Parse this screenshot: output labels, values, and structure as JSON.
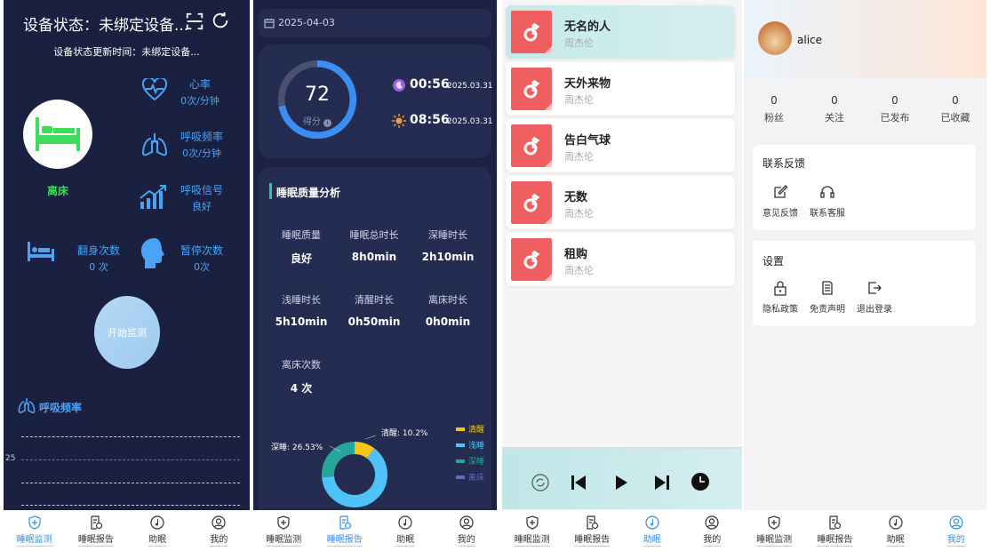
{
  "tabs": [
    "睡眠监测",
    "睡眠报告",
    "助眠",
    "我的"
  ],
  "monitor": {
    "title": "设备状态：未绑定设备...",
    "subtitle": "设备状态更新时间：未绑定设备...",
    "bed_status": "离床",
    "heart_rate_label": "心率",
    "heart_rate_value": "0次/分钟",
    "resp_rate_label": "呼吸频率",
    "resp_rate_value": "0次/分钟",
    "resp_signal_label": "呼吸信号",
    "resp_signal_value": "良好",
    "turn_label": "翻身次数",
    "turn_value": "0 次",
    "pause_label": "暂停次数",
    "pause_value": "0次",
    "start_button": "开始监测",
    "chart_title": "呼吸频率",
    "chart_tick": "25"
  },
  "report": {
    "date": "2025-04-03",
    "score": "72",
    "score_label": "得分",
    "score_fraction": 0.72,
    "sleep_time": "00:56",
    "sleep_date": "2025.03.31",
    "wake_time": "08:56",
    "wake_date": "2025.03.31",
    "section_title": "睡眠质量分析",
    "stats": [
      {
        "k": "睡眠质量",
        "v": "良好"
      },
      {
        "k": "睡眠总时长",
        "v": "8h0min"
      },
      {
        "k": "深睡时长",
        "v": "2h10min"
      },
      {
        "k": "浅睡时长",
        "v": "5h10min"
      },
      {
        "k": "清醒时长",
        "v": "0h50min"
      },
      {
        "k": "离床时长",
        "v": "0h0min"
      },
      {
        "k": "离床次数",
        "v": "4 次"
      }
    ],
    "chart_data": {
      "type": "pie",
      "slices": [
        {
          "name": "清醒",
          "value": 10.2,
          "color": "#f5c518"
        },
        {
          "name": "浅睡",
          "value": 63.27,
          "color": "#4fc3f7"
        },
        {
          "name": "深睡",
          "value": 26.53,
          "color": "#26a69a"
        },
        {
          "name": "离床",
          "value": 0,
          "color": "#5c6bc0"
        }
      ],
      "labels": [
        "清醒: 10.2%",
        "深睡: 26.53%"
      ],
      "legend": [
        "清醒",
        "浅睡",
        "深睡",
        "离床"
      ]
    }
  },
  "music": {
    "songs": [
      {
        "name": "无名的人",
        "artist": "周杰伦"
      },
      {
        "name": "天外来物",
        "artist": "周杰伦"
      },
      {
        "name": "告白气球",
        "artist": "周杰伦"
      },
      {
        "name": "无数",
        "artist": "周杰伦"
      },
      {
        "name": "租购",
        "artist": "周杰伦"
      }
    ]
  },
  "profile": {
    "username": "alice",
    "counts": [
      {
        "n": "0",
        "t": "粉丝"
      },
      {
        "n": "0",
        "t": "关注"
      },
      {
        "n": "0",
        "t": "已发布"
      },
      {
        "n": "0",
        "t": "已收藏"
      }
    ],
    "feedback_title": "联系反馈",
    "feedback_opts": [
      "意见反馈",
      "联系客服"
    ],
    "settings_title": "设置",
    "settings_opts": [
      "隐私政策",
      "免责声明",
      "退出登录"
    ]
  }
}
